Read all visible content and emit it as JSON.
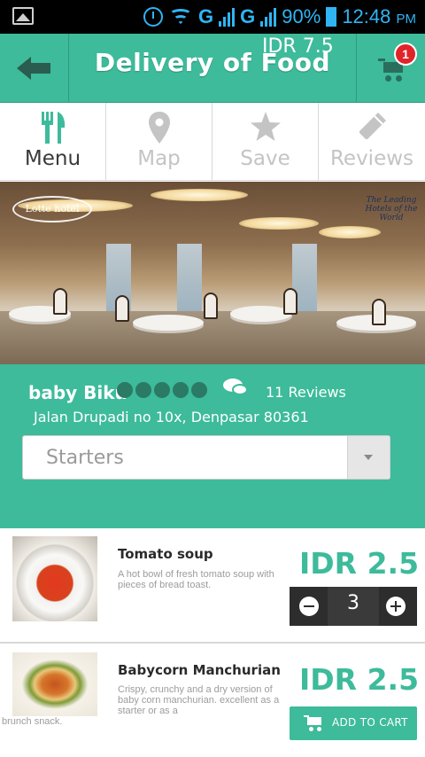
{
  "status_bar": {
    "network_1": "G",
    "network_2": "G",
    "battery": "90%",
    "time": "12:48",
    "ampm": "PM"
  },
  "header": {
    "title": "Delivery of Food",
    "price_overlay": "IDR 7.5",
    "cart_count": "1",
    "accent_color": "#3dbb9b"
  },
  "tabs": [
    {
      "label": "Menu",
      "icon": "fork-knife-icon",
      "active": true
    },
    {
      "label": "Map",
      "icon": "map-pin-icon",
      "active": false
    },
    {
      "label": "Save",
      "icon": "star-icon",
      "active": false
    },
    {
      "label": "Reviews",
      "icon": "pencil-icon",
      "active": false
    }
  ],
  "hero": {
    "badge_left": "Lotte hotel",
    "badge_right": "The Leading Hotels of the World"
  },
  "restaurant": {
    "name": "baby Biku",
    "rating": 5,
    "reviews": "11 Reviews",
    "address": "Jalan Drupadi no 10x, Denpasar 80361"
  },
  "category_select": {
    "value": "Starters"
  },
  "items": [
    {
      "name": "Tomato soup",
      "description": "A hot bowl of fresh tomato soup with pieces of bread toast.",
      "price": "IDR 2.5",
      "quantity": "3"
    },
    {
      "name": "Babycorn Manchurian",
      "description": "Crispy, crunchy and a dry version of baby corn manchurian. excellent as a starter or as a",
      "description_tail": "brunch snack.",
      "price": "IDR 2.5",
      "button_label": "ADD TO CART"
    }
  ]
}
